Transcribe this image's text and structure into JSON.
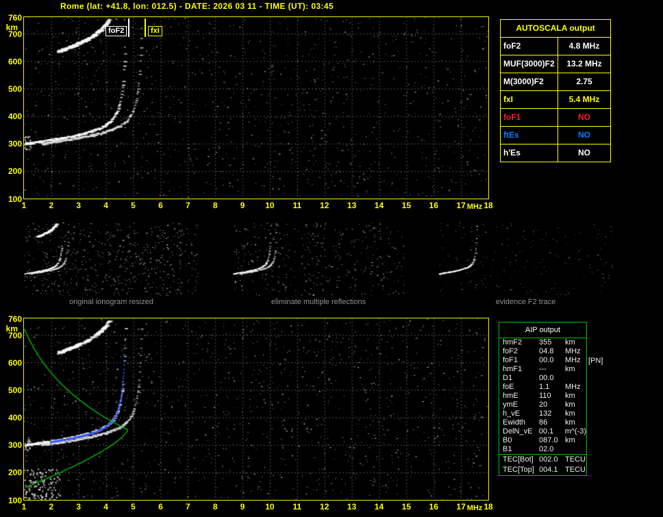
{
  "header": {
    "title": "Rome (lat: +41.8, lon: 012.5) - DATE: 2026 03 11 - TIME (UT): 03:45"
  },
  "axes": {
    "y_unit": "km",
    "x_unit": "MHz",
    "y_ticks": [
      "760",
      "700",
      "600",
      "500",
      "400",
      "300",
      "200",
      "100"
    ],
    "x_ticks": [
      "1",
      "2",
      "3",
      "4",
      "5",
      "6",
      "7",
      "8",
      "9",
      "10",
      "11",
      "12",
      "13",
      "14",
      "15",
      "16",
      "17",
      "18"
    ]
  },
  "top_plot": {
    "markers": {
      "foF2_label": "foF2",
      "foF2_mhz": 4.8,
      "fxI_label": "fxI",
      "fxI_mhz": 5.4
    }
  },
  "autoscala": {
    "title": "AUTOSCALA output",
    "rows": [
      {
        "param": "foF2",
        "value": "4.8 MHz",
        "color": "#ffffff"
      },
      {
        "param": "MUF(3000)F2",
        "value": "13.2 MHz",
        "color": "#ffffff"
      },
      {
        "param": "M(3000)F2",
        "value": "2.75",
        "color": "#ffffff"
      },
      {
        "param": "fxI",
        "value": "5.4 MHz",
        "color": "#ffff00"
      },
      {
        "param": "foF1",
        "value": "NO",
        "color": "#ff2020"
      },
      {
        "param": "ftEs",
        "value": "NO",
        "color": "#0080ff"
      },
      {
        "param": "h'Es",
        "value": "NO",
        "color": "#ffffff"
      }
    ]
  },
  "thumbnails": [
    {
      "caption": "original ionogram resized"
    },
    {
      "caption": "eliminate multiple reflections"
    },
    {
      "caption": "evidence F2 trace"
    }
  ],
  "aip": {
    "title": "AIP output",
    "rows": [
      {
        "param": "hmF2",
        "value": "355",
        "unit": "km"
      },
      {
        "param": "foF2",
        "value": "04.8",
        "unit": "MHz"
      },
      {
        "param": "foF1",
        "value": "00.0",
        "unit": "MHz",
        "extra": "[PN]"
      },
      {
        "param": "hmF1",
        "value": "---",
        "unit": "km"
      },
      {
        "param": "D1",
        "value": "00.0",
        "unit": ""
      },
      {
        "param": "foE",
        "value": "1.1",
        "unit": "MHz"
      },
      {
        "param": "hmE",
        "value": "110",
        "unit": "km"
      },
      {
        "param": "ymE",
        "value": "20",
        "unit": "km"
      },
      {
        "param": "h_vE",
        "value": "132",
        "unit": "km"
      },
      {
        "param": "Ewidth",
        "value": "86",
        "unit": "km"
      },
      {
        "param": "DelN_vE",
        "value": "00.1",
        "unit": "m^(-3)"
      },
      {
        "param": "B0",
        "value": "087.0",
        "unit": "km"
      },
      {
        "param": "B1",
        "value": "02.0",
        "unit": ""
      }
    ],
    "tec_rows": [
      {
        "param": "TEC[Bot]",
        "value": "002.0",
        "unit": "TECU"
      },
      {
        "param": "TEC[Top]",
        "value": "004.1",
        "unit": "TECU"
      }
    ]
  },
  "chart_data": [
    {
      "type": "scatter",
      "title": "ionogram with autoscaled characteristics (top plot)",
      "xlabel": "MHz",
      "ylabel": "km",
      "xlim": [
        1,
        18
      ],
      "ylim": [
        100,
        760
      ],
      "grid": true,
      "annotations": [
        {
          "label": "foF2",
          "x": 4.8,
          "color": "#ffffff"
        },
        {
          "label": "fxI",
          "x": 5.4,
          "color": "#ffff00"
        }
      ],
      "series": [
        {
          "name": "F2 ordinary trace",
          "points": [
            [
              1.0,
              305
            ],
            [
              2.0,
              315
            ],
            [
              3.0,
              335
            ],
            [
              3.5,
              348
            ],
            [
              4.0,
              372
            ],
            [
              4.3,
              403
            ],
            [
              4.5,
              458
            ],
            [
              4.6,
              528
            ],
            [
              4.7,
              672
            ],
            [
              4.76,
              760
            ]
          ]
        },
        {
          "name": "F2 extraordinary trace",
          "points": [
            [
              1.7,
              305
            ],
            [
              2.6,
              315
            ],
            [
              3.6,
              335
            ],
            [
              4.6,
              372
            ],
            [
              5.1,
              470
            ],
            [
              5.25,
              650
            ],
            [
              5.35,
              760
            ]
          ]
        },
        {
          "name": "second-order reflection",
          "points": [
            [
              2.3,
              634
            ],
            [
              3.1,
              675
            ],
            [
              3.8,
              716
            ],
            [
              4.1,
              758
            ]
          ]
        }
      ]
    },
    {
      "type": "scatter",
      "title": "ionogram with restored trace and electron density profile (bottom plot)",
      "xlabel": "MHz",
      "ylabel": "km",
      "xlim": [
        1,
        18
      ],
      "ylim": [
        100,
        760
      ],
      "grid": true,
      "series": [
        {
          "name": "F2 ordinary trace (white)",
          "points": [
            [
              1.0,
              305
            ],
            [
              2.0,
              315
            ],
            [
              3.0,
              335
            ],
            [
              4.0,
              372
            ],
            [
              4.5,
              458
            ],
            [
              4.7,
              672
            ],
            [
              4.76,
              760
            ]
          ]
        },
        {
          "name": "fitted trace (blue)",
          "points": [
            [
              2.0,
              315
            ],
            [
              3.0,
              335
            ],
            [
              4.0,
              372
            ],
            [
              4.5,
              458
            ],
            [
              4.76,
              635
            ]
          ]
        },
        {
          "name": "electron density profile (green), peak at foF2=4.8 MHz / hmF2=355 km",
          "points": [
            [
              1.0,
              724
            ],
            [
              2.4,
              520
            ],
            [
              4.0,
              398
            ],
            [
              4.8,
              355
            ],
            [
              4.2,
              300
            ],
            [
              3.4,
              250
            ],
            [
              2.3,
              200
            ],
            [
              1.2,
              150
            ]
          ]
        }
      ]
    }
  ]
}
